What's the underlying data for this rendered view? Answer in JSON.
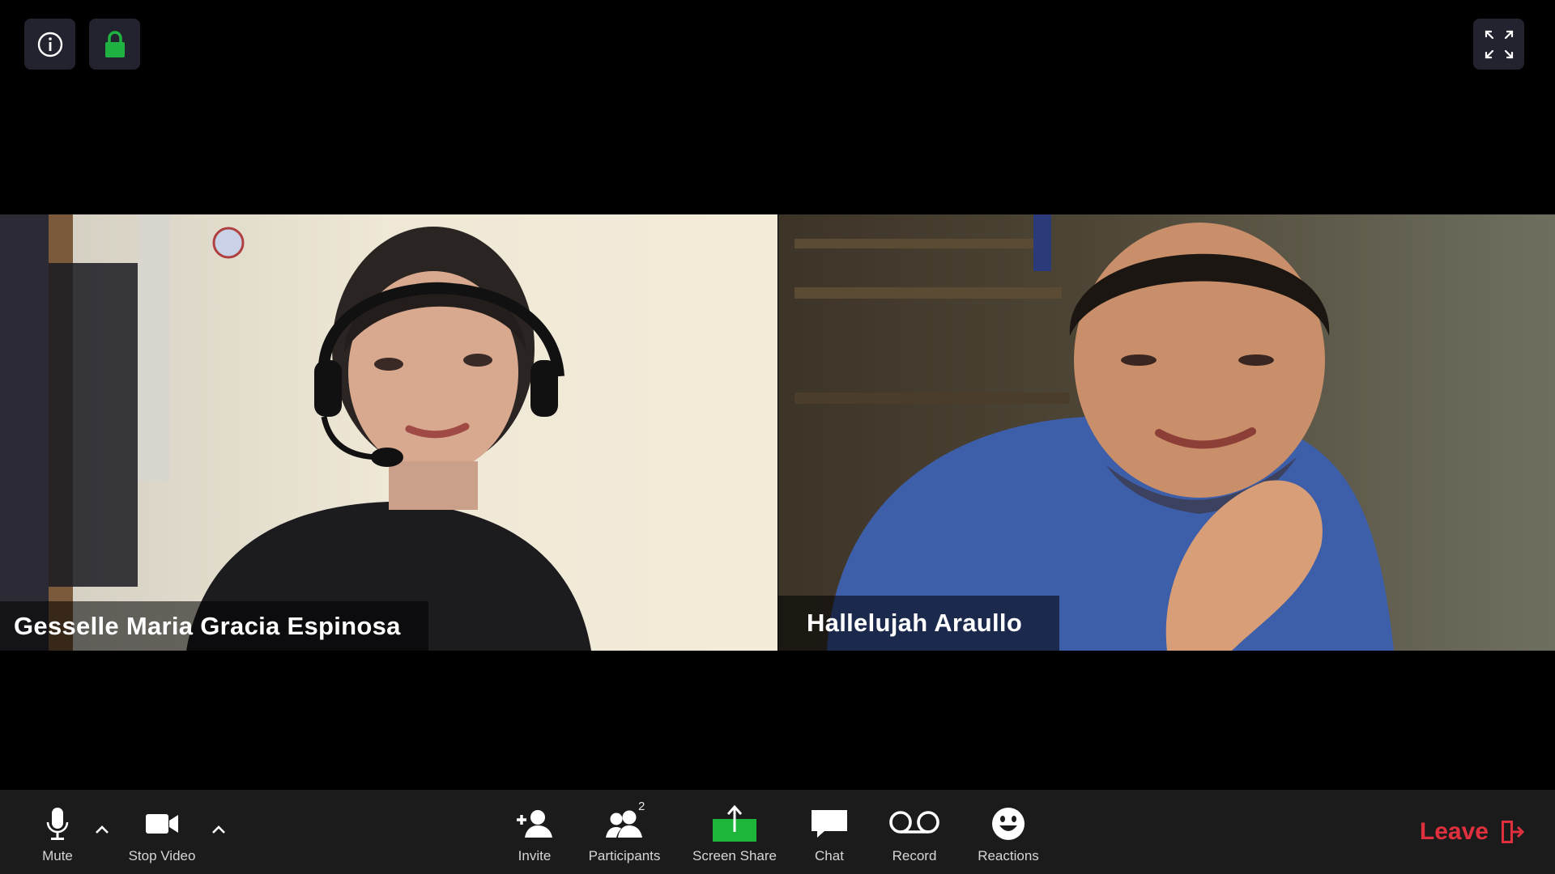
{
  "top_controls": {
    "info_icon": "info-icon",
    "lock_icon": "lock-icon",
    "lock_color": "#1fb141",
    "fullscreen_icon": "fullscreen-icon"
  },
  "gallery": {
    "participants": [
      {
        "name": "Gesselle Maria Gracia Espinosa"
      },
      {
        "name": "Hallelujah Araullo"
      }
    ]
  },
  "toolbar": {
    "mute_label": "Mute",
    "stop_video_label": "Stop Video",
    "invite_label": "Invite",
    "participants_label": "Participants",
    "participants_count": "2",
    "screen_share_label": "Screen Share",
    "screen_share_color": "#1db63b",
    "chat_label": "Chat",
    "record_label": "Record",
    "reactions_label": "Reactions",
    "leave_label": "Leave",
    "leave_color": "#e0303d"
  }
}
